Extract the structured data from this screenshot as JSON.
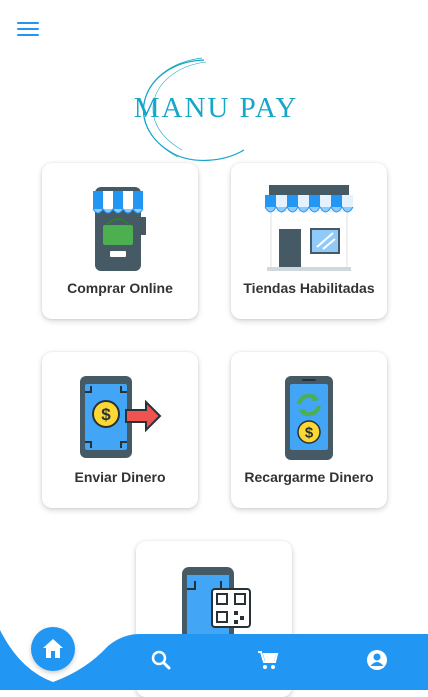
{
  "app": {
    "logo_text": "MANU PAY"
  },
  "header": {
    "menu_icon": "hamburger-menu-icon"
  },
  "cards": [
    {
      "label": "Comprar Online",
      "icon": "mobile-shop-icon"
    },
    {
      "label": "Tiendas Habilitadas",
      "icon": "store-front-icon"
    },
    {
      "label": "Enviar Dinero",
      "icon": "send-money-phone-icon"
    },
    {
      "label": "Recargarme Dinero",
      "icon": "recharge-phone-icon"
    },
    {
      "label": "",
      "icon": "qr-scan-phone-icon"
    }
  ],
  "bottom_nav": {
    "items": [
      "home-icon",
      "search-icon",
      "cart-icon",
      "account-icon"
    ],
    "colors": {
      "accent": "#2196f3",
      "icon": "#ffffff"
    }
  },
  "colors": {
    "brand": "#16a6c8",
    "accent": "#2196f3",
    "card_text": "#333333"
  }
}
